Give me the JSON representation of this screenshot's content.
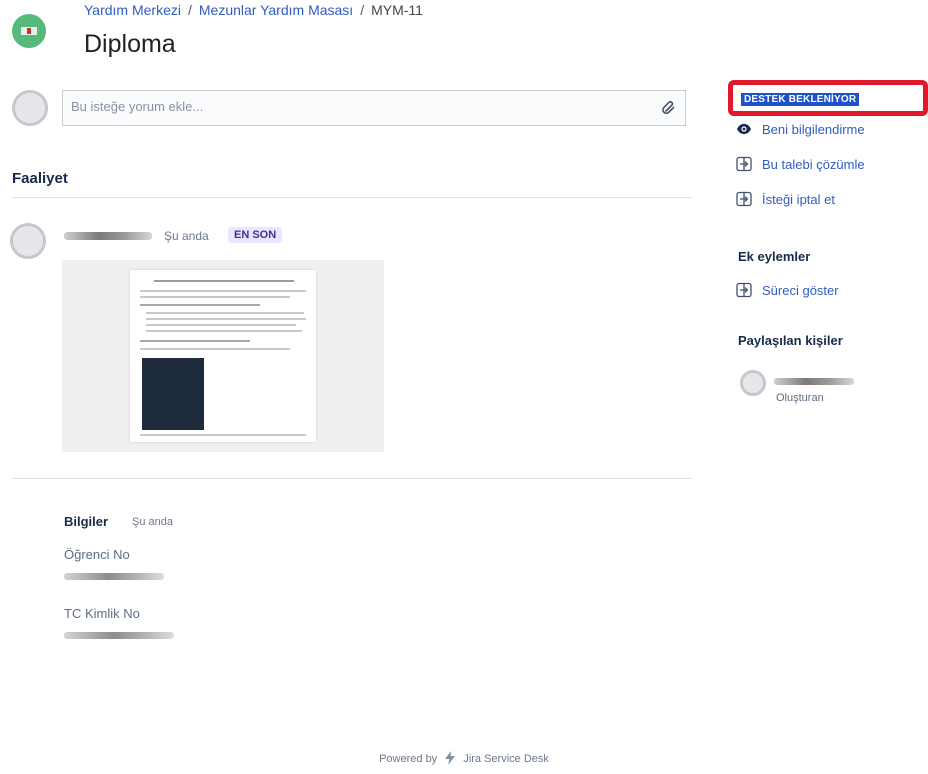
{
  "breadcrumb": {
    "items": [
      "Yardım Merkezi",
      "Mezunlar Yardım Masası"
    ],
    "current": "MYM-11",
    "separator": "/"
  },
  "request": {
    "title": "Diploma"
  },
  "comment": {
    "placeholder": "Bu isteğe yorum ekle..."
  },
  "activity": {
    "heading": "Faaliyet",
    "entry": {
      "time": "Şu anda",
      "badge": "EN SON"
    }
  },
  "info": {
    "title": "Bilgiler",
    "time": "Şu anda",
    "fields": [
      {
        "label": "Öğrenci No"
      },
      {
        "label": "TC Kimlik No"
      }
    ]
  },
  "sidebar": {
    "status": "DESTEK BEKLENİYOR",
    "actions": [
      {
        "label": "Beni bilgilendirme",
        "icon": "eye-icon"
      },
      {
        "label": "Bu talebi çözümle",
        "icon": "transition-icon"
      },
      {
        "label": "İsteği iptal et",
        "icon": "transition-icon"
      }
    ],
    "more_actions_heading": "Ek eylemler",
    "more_actions": [
      {
        "label": "Süreci göster",
        "icon": "transition-icon"
      }
    ],
    "shared_heading": "Paylaşılan kişiler",
    "shared_role": "Oluşturan"
  },
  "footer": {
    "powered_by": "Powered by",
    "product": "Jira Service Desk"
  },
  "colors": {
    "link": "#2f5dbf",
    "status_lozenge": "#1f52c9",
    "highlight": "#e0192c",
    "badge_bg": "#eae6ff",
    "badge_text": "#403294"
  }
}
